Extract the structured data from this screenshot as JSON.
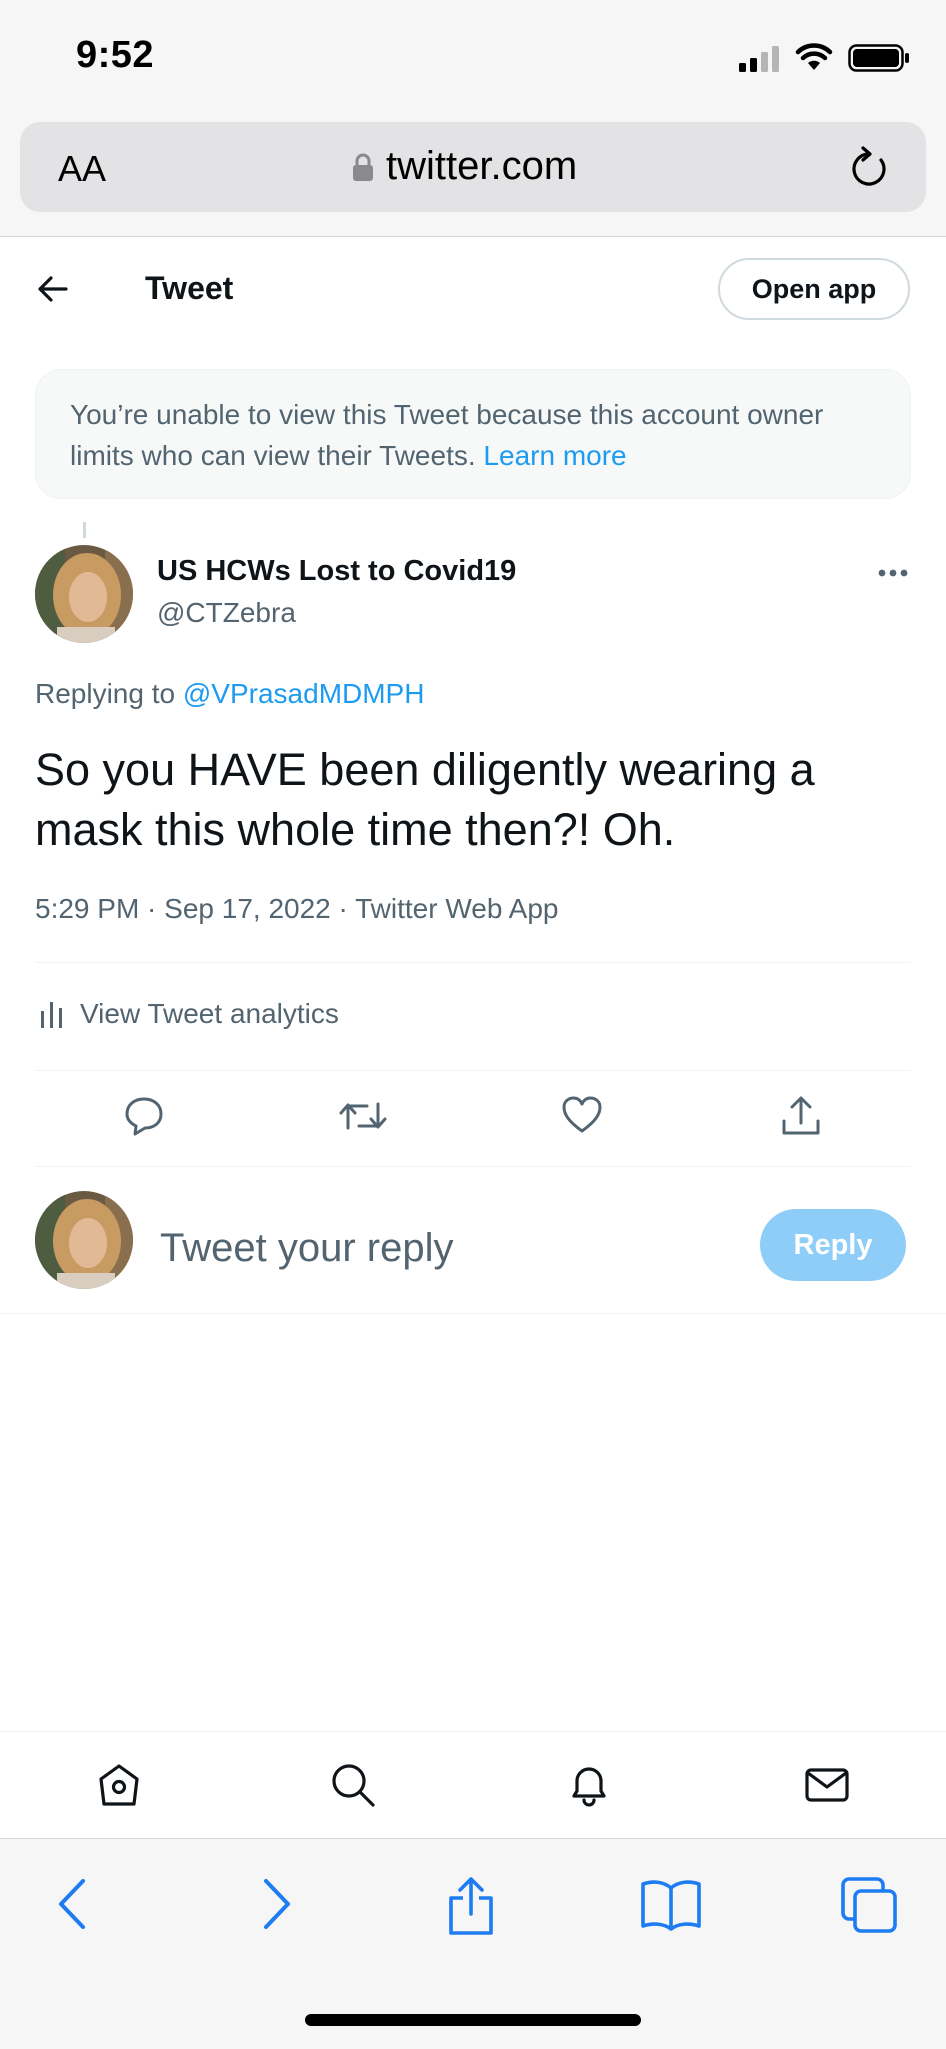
{
  "status_bar": {
    "time": "9:52"
  },
  "browser": {
    "text_size_label": "AA",
    "url": "twitter.com"
  },
  "header": {
    "title": "Tweet",
    "open_app_label": "Open app"
  },
  "notice": {
    "text": "You’re unable to view this Tweet because this account owner limits who can view their Tweets.",
    "link": "Learn more"
  },
  "tweet": {
    "author_name": "US HCWs Lost to Covid19",
    "author_handle": "@CTZebra",
    "replying_prefix": "Replying to",
    "replying_to": "@VPrasadMDMPH",
    "text": "So you HAVE been diligently wearing a mask this whole time then?! Oh.",
    "meta": "5:29 PM · Sep 17, 2022 · Twitter Web App",
    "analytics_label": "View Tweet analytics"
  },
  "composer": {
    "placeholder": "Tweet your reply",
    "reply_label": "Reply"
  },
  "colors": {
    "accent": "#1d9bf0",
    "reply_disabled": "#8ecdf8",
    "safari_blue": "#1e7cf2",
    "muted": "#536471"
  },
  "icons": {
    "twitter_nav": [
      "home-icon",
      "search-icon",
      "notifications-icon",
      "messages-icon"
    ],
    "safari_toolbar": [
      "back-icon",
      "forward-icon",
      "share-icon",
      "bookmarks-icon",
      "tabs-icon"
    ],
    "tweet_actions": [
      "reply-icon",
      "retweet-icon",
      "like-icon",
      "share-icon"
    ]
  }
}
